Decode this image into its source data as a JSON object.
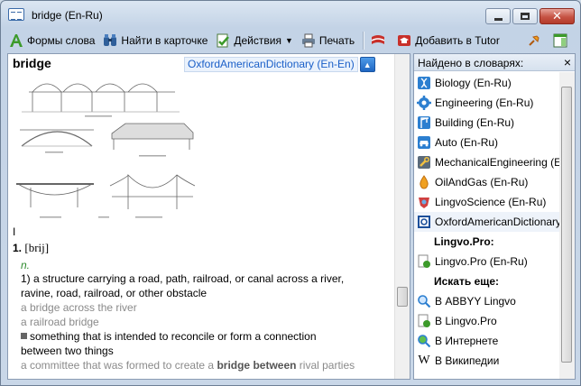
{
  "window": {
    "title": "bridge (En-Ru)"
  },
  "toolbar": {
    "forms_label": "Формы слова",
    "find_label": "Найти в карточке",
    "actions_label": "Действия",
    "print_label": "Печать",
    "add_tutor_label": "Добавить в Tutor"
  },
  "article": {
    "headword": "bridge",
    "dictionary": "OxfordAmericanDictionary (En-En)",
    "roman_numeral": "I",
    "sense_number": "1.",
    "transcription": "[brij]",
    "pos": "n.",
    "definitions": [
      "1) a structure carrying a road, path, railroad, or canal across a river,",
      "ravine, road, railroad, or other obstacle"
    ],
    "examples": [
      "a bridge across the river",
      "a railroad bridge"
    ],
    "def2_lines": [
      "something that is intended to reconcile or form a connection",
      "between two things"
    ],
    "example3_pre": "a committee that was formed to create a ",
    "example3_bold": "bridge between",
    "example3_post": " rival parties"
  },
  "sidebar": {
    "header": "Найдено в словарях:",
    "dictionaries": [
      {
        "label": "Biology (En-Ru)",
        "icon": "dna-icon"
      },
      {
        "label": "Engineering (En-Ru)",
        "icon": "gear-icon"
      },
      {
        "label": "Building (En-Ru)",
        "icon": "crane-icon"
      },
      {
        "label": "Auto (En-Ru)",
        "icon": "car-icon"
      },
      {
        "label": "MechanicalEngineering (En-Ru)",
        "icon": "wrench-icon"
      },
      {
        "label": "OilAndGas (En-Ru)",
        "icon": "oil-drop-icon"
      },
      {
        "label": "LingvoScience (En-Ru)",
        "icon": "science-icon"
      },
      {
        "label": "OxfordAmericanDictionary (En-En)",
        "icon": "oxford-icon"
      }
    ],
    "pro_header": "Lingvo.Pro:",
    "pro_items": [
      {
        "label": "Lingvo.Pro (En-Ru)"
      }
    ],
    "search_header": "Искать еще:",
    "search_items": [
      {
        "label": "В ABBYY Lingvo"
      },
      {
        "label": "В Lingvo.Pro"
      },
      {
        "label": "В Интернете"
      },
      {
        "label": "В Википедии"
      }
    ]
  },
  "colors": {
    "link": "#1a5fc8",
    "example": "#8a8a8a",
    "pos": "#2e8b2e",
    "close": "#c65344"
  }
}
